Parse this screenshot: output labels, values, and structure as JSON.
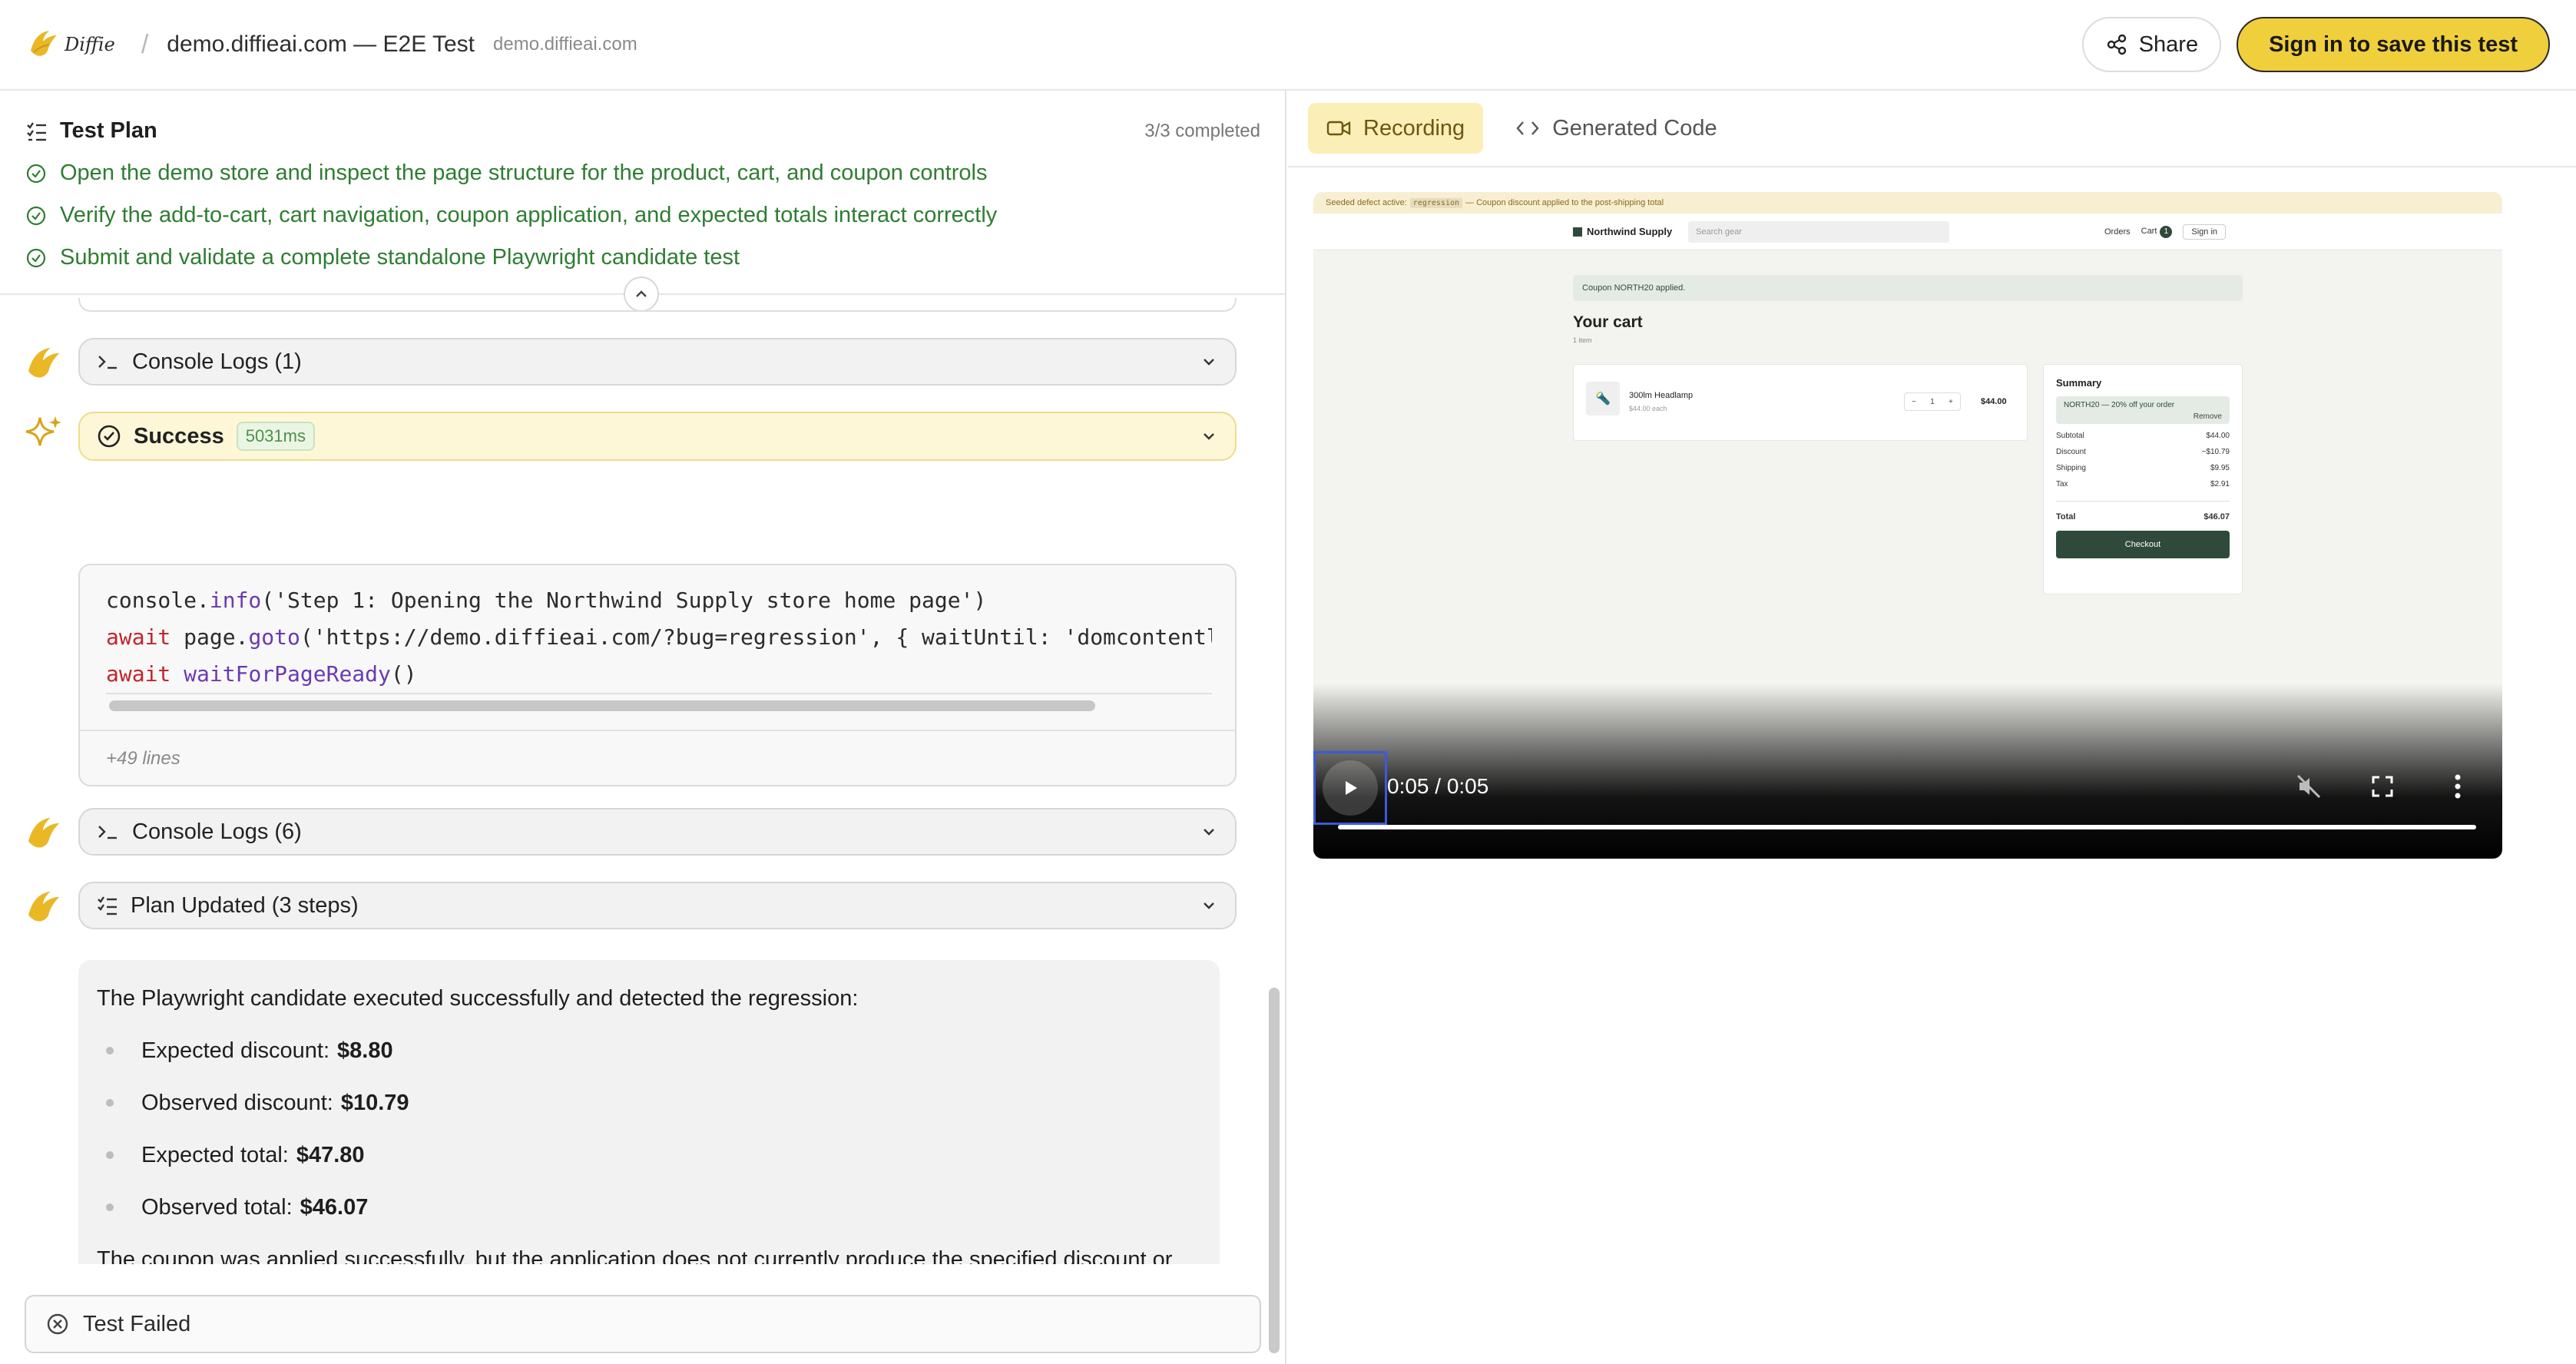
{
  "header": {
    "logo_text": "Diffie",
    "separator": "/",
    "title": "demo.diffieai.com — E2E Test",
    "domain": "demo.diffieai.com",
    "share_label": "Share",
    "signin_label": "Sign in to save this test",
    "accent_color": "#f0cf3d"
  },
  "plan": {
    "title": "Test Plan",
    "completed": "3/3 completed",
    "steps": [
      "Open the demo store and inspect the page structure for the product, cart, and coupon controls",
      "Verify the add-to-cart, cart navigation, coupon application, and expected totals interact correctly",
      "Submit and validate a complete standalone Playwright candidate test"
    ],
    "step_color": "#2f7d32"
  },
  "feed": {
    "console_logs_1": "Console Logs (1)",
    "success_label": "Success",
    "success_ms": "5031ms",
    "more_lines": "+49 lines",
    "console_logs_2": "Console Logs (6)",
    "plan_updated": "Plan Updated (3 steps)"
  },
  "result": {
    "intro": "The Playwright candidate executed successfully and detected the regression:",
    "items": [
      {
        "label": "Expected discount:",
        "value": "$8.80"
      },
      {
        "label": "Observed discount:",
        "value": "$10.79"
      },
      {
        "label": "Expected total:",
        "value": "$47.80"
      },
      {
        "label": "Observed total:",
        "value": "$46.07"
      }
    ],
    "conclusion": "The coupon was applied successfully, but the application does not currently produce the specified discount or order total."
  },
  "status": {
    "label": "Test Failed"
  },
  "tabs": {
    "recording": "Recording",
    "generated_code": "Generated Code"
  },
  "video": {
    "time": "0:05 / 0:05",
    "progress": 1.0,
    "defect_prefix": "Seeded defect active:",
    "defect_code": "regression",
    "defect_suffix": "— Coupon discount applied to the post-shipping total",
    "store_name": "Northwind Supply",
    "search_placeholder": "Search gear",
    "nav_orders": "Orders",
    "nav_cart": "Cart",
    "cart_count": "1",
    "nav_signin": "Sign in",
    "coupon_applied": "Coupon NORTH20 applied.",
    "cart_title": "Your cart",
    "cart_sub": "1 item",
    "item_name": "300lm Headlamp",
    "item_each": "$44.00 each",
    "qty_minus": "−",
    "qty_value": "1",
    "qty_plus": "+",
    "item_price": "$44.00",
    "summary_title": "Summary",
    "coupon_line": "NORTH20 — 20% off your order",
    "remove": "Remove",
    "subtotal_label": "Subtotal",
    "subtotal": "$44.00",
    "discount_label": "Discount",
    "discount": "−$10.79",
    "shipping_label": "Shipping",
    "shipping": "$9.95",
    "tax_label": "Tax",
    "tax": "$2.91",
    "total_label": "Total",
    "total": "$46.07",
    "checkout": "Checkout"
  }
}
